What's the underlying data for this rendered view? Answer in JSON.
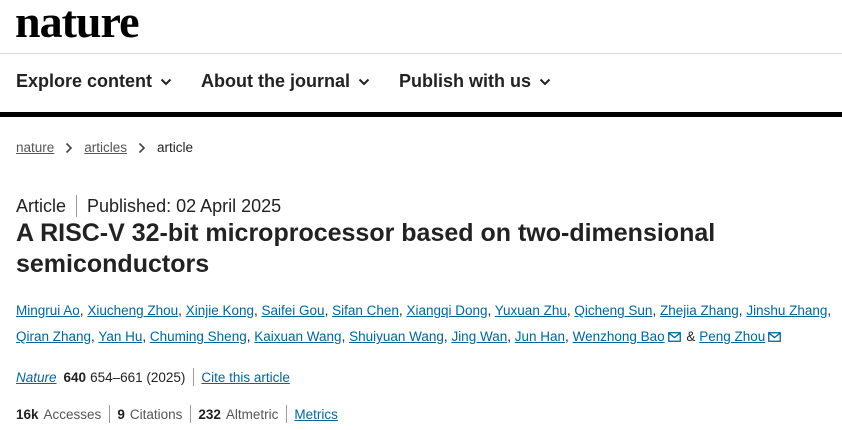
{
  "header": {
    "logo": "nature"
  },
  "nav": {
    "items": [
      {
        "label": "Explore content"
      },
      {
        "label": "About the journal"
      },
      {
        "label": "Publish with us"
      }
    ]
  },
  "breadcrumb": {
    "items": [
      "nature",
      "articles",
      "article"
    ]
  },
  "article": {
    "type": "Article",
    "published": "Published: 02 April 2025",
    "title": "A RISC-V 32-bit microprocessor based on two-dimensional semiconductors",
    "authors": [
      "Mingrui Ao",
      "Xiucheng Zhou",
      "Xinjie Kong",
      "Saifei Gou",
      "Sifan Chen",
      "Xiangqi Dong",
      "Yuxuan Zhu",
      "Qicheng Sun",
      "Zhejia Zhang",
      "Jinshu Zhang",
      "Qiran Zhang",
      "Yan Hu",
      "Chuming Sheng",
      "Kaixuan Wang",
      "Shuiyuan Wang",
      "Jing Wan",
      "Jun Han",
      "Wenzhong Bao",
      "Peng Zhou"
    ],
    "author_separator": ",",
    "author_and": "&",
    "journal": "Nature",
    "volume": "640",
    "pages_year": "654–661 (2025)",
    "cite_label": "Cite this article"
  },
  "metrics": {
    "accesses_value": "16k",
    "accesses_label": "Accesses",
    "citations_value": "9",
    "citations_label": "Citations",
    "altmetric_value": "232",
    "altmetric_label": "Altmetric",
    "metrics_link": "Metrics"
  },
  "colors": {
    "link": "#006699",
    "text": "#222222",
    "rule": "#000000"
  }
}
